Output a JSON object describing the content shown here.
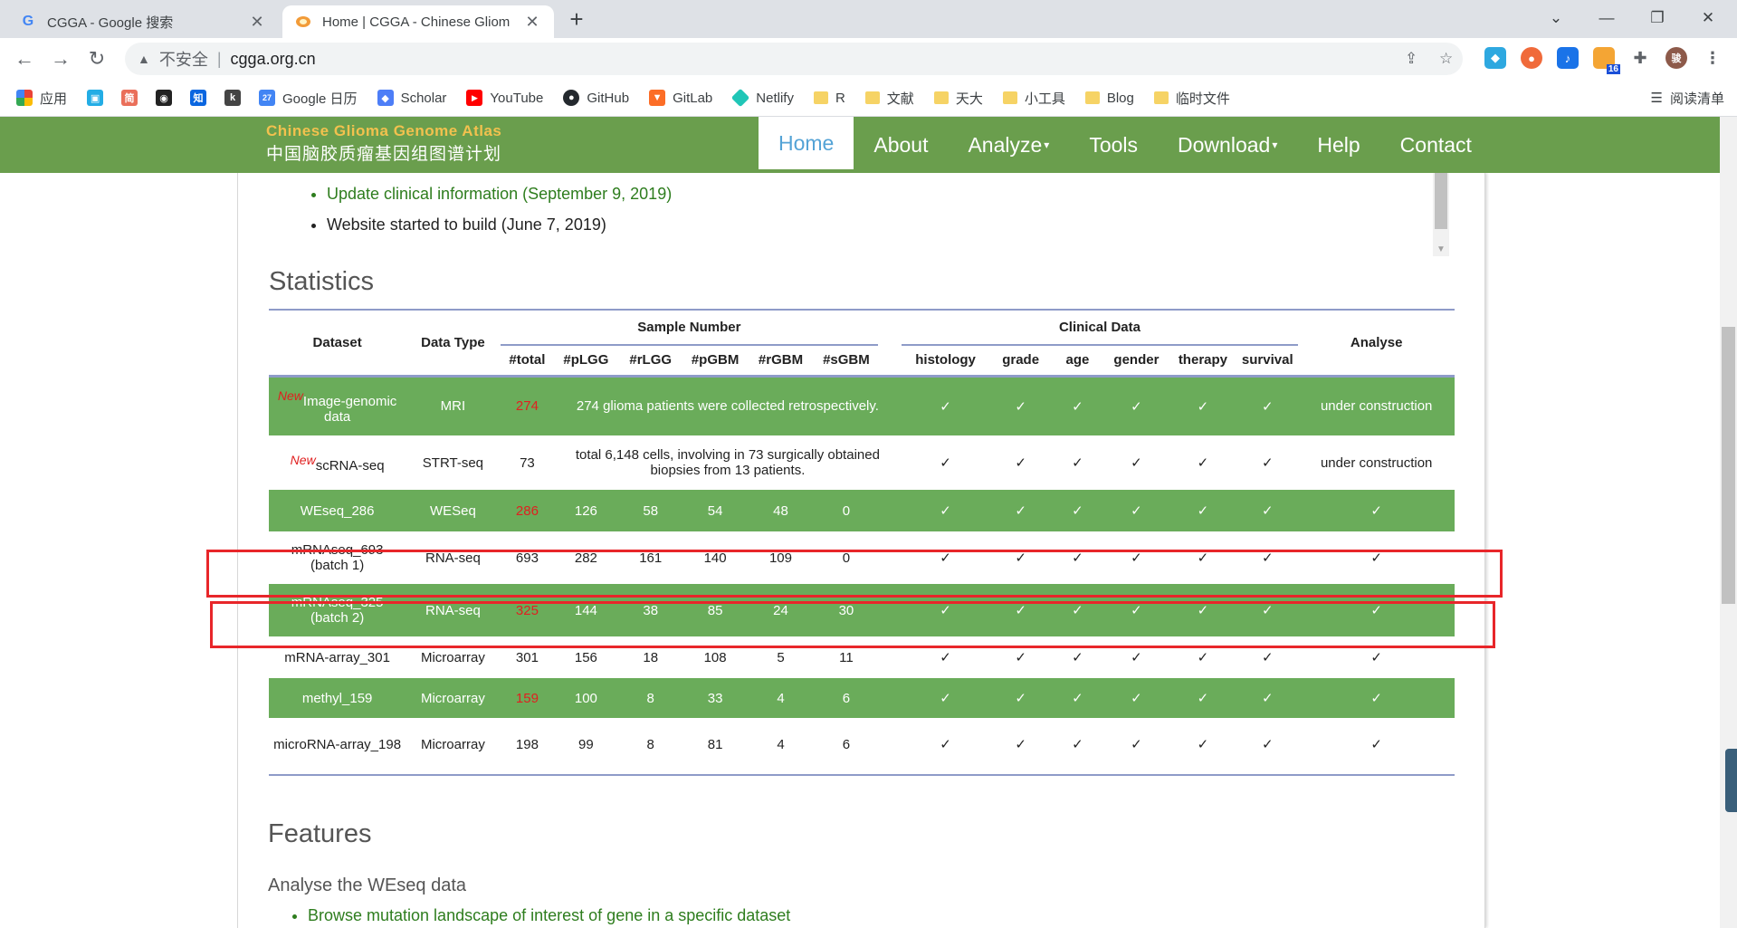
{
  "browser": {
    "tabs": [
      {
        "favicon": "G",
        "title": "CGGA - Google 搜索",
        "active": false
      },
      {
        "favicon": "egg",
        "title": "Home | CGGA - Chinese Gliom",
        "active": true
      }
    ],
    "omnibox": {
      "insecure_label": "不安全",
      "url": "cgga.org.cn"
    },
    "extension_badge": "16",
    "profile_initial": "骏",
    "bookmarks": [
      {
        "label": "应用",
        "icon": "apps-grid-icon",
        "color": "#4285f4"
      },
      {
        "label": "",
        "icon": "bilibili-icon",
        "color": "#23ade5"
      },
      {
        "label": "",
        "icon": "jianshu-icon",
        "color": "#ea6f5a",
        "glyph": "简"
      },
      {
        "label": "",
        "icon": "owl-icon",
        "color": "#222222"
      },
      {
        "label": "",
        "icon": "zhihu-icon",
        "color": "#0a66e0",
        "glyph": "知"
      },
      {
        "label": "",
        "icon": "kaggle-icon",
        "color": "#444444",
        "glyph": "k"
      },
      {
        "label": "Google 日历",
        "icon": "calendar-icon",
        "color": "#4285f4",
        "glyph": "27"
      },
      {
        "label": "Scholar",
        "icon": "scholar-icon",
        "color": "#4d7ef7"
      },
      {
        "label": "YouTube",
        "icon": "youtube-icon",
        "color": "#ff0000"
      },
      {
        "label": "GitHub",
        "icon": "github-icon",
        "color": "#24292e"
      },
      {
        "label": "GitLab",
        "icon": "gitlab-icon",
        "color": "#fc6d26"
      },
      {
        "label": "Netlify",
        "icon": "netlify-icon",
        "color": "#20c6b7"
      },
      {
        "label": "R",
        "icon": "folder-icon"
      },
      {
        "label": "文献",
        "icon": "folder-icon"
      },
      {
        "label": "天大",
        "icon": "folder-icon"
      },
      {
        "label": "小工具",
        "icon": "folder-icon"
      },
      {
        "label": "Blog",
        "icon": "folder-icon"
      },
      {
        "label": "临时文件",
        "icon": "folder-icon"
      }
    ],
    "reading_list": "阅读清单"
  },
  "site": {
    "logo_en": "Chinese Glioma Genome Atlas",
    "logo_cn": "中国脑胶质瘤基因组图谱计划",
    "nav": [
      "Home",
      "About",
      "Analyze",
      "Tools",
      "Download",
      "Help",
      "Contact"
    ],
    "active_nav": "Home",
    "updates": [
      "Update clinical information (September 9, 2019)",
      "Website started to build (June 7, 2019)"
    ]
  },
  "statistics": {
    "heading": "Statistics",
    "headers": {
      "dataset": "Dataset",
      "data_type": "Data Type",
      "sample_number": "Sample Number",
      "clinical_data": "Clinical Data",
      "analyse": "Analyse",
      "sample_cols": [
        "#total",
        "#pLGG",
        "#rLGG",
        "#pGBM",
        "#rGBM",
        "#sGBM"
      ],
      "clinical_cols": [
        "histology",
        "grade",
        "age",
        "gender",
        "therapy",
        "survival"
      ]
    },
    "new_tag": "New",
    "check": "✓",
    "rows": [
      {
        "dataset": "Image-genomic data",
        "new": true,
        "type": "MRI",
        "total": "274",
        "note": "274 glioma patients were collected retrospectively.",
        "analyse": "under construction"
      },
      {
        "dataset": "scRNA-seq",
        "new": true,
        "type": "STRT-seq",
        "total": "73",
        "note": "total 6,148 cells, involving in 73 surgically obtained biopsies from 13 patients.",
        "analyse": "under construction"
      },
      {
        "dataset": "WEseq_286",
        "type": "WESeq",
        "total": "286",
        "counts": [
          "126",
          "58",
          "54",
          "48",
          "0"
        ],
        "analyse": "✓"
      },
      {
        "dataset": "mRNAseq_693 (batch 1)",
        "type": "RNA-seq",
        "total": "693",
        "counts": [
          "282",
          "161",
          "140",
          "109",
          "0"
        ],
        "analyse": "✓"
      },
      {
        "dataset": "mRNAseq_325 (batch 2)",
        "type": "RNA-seq",
        "total": "325",
        "counts": [
          "144",
          "38",
          "85",
          "24",
          "30"
        ],
        "analyse": "✓"
      },
      {
        "dataset": "mRNA-array_301",
        "type": "Microarray",
        "total": "301",
        "counts": [
          "156",
          "18",
          "108",
          "5",
          "11"
        ],
        "analyse": "✓"
      },
      {
        "dataset": "methyl_159",
        "type": "Microarray",
        "total": "159",
        "counts": [
          "100",
          "8",
          "33",
          "4",
          "6"
        ],
        "analyse": "✓"
      },
      {
        "dataset": "microRNA-array_198",
        "type": "Microarray",
        "total": "198",
        "counts": [
          "99",
          "8",
          "81",
          "4",
          "6"
        ],
        "analyse": "✓"
      }
    ]
  },
  "features": {
    "heading": "Features",
    "subheading": "Analyse the WEseq data",
    "items": [
      "Browse mutation landscape of interest of gene in a specific dataset"
    ]
  },
  "colors": {
    "nav_green": "#6a9e4d",
    "row_green": "#6aac5a",
    "highlight_red": "#e8262a",
    "total_red": "#e02020",
    "link_green": "#2e7d1e"
  }
}
